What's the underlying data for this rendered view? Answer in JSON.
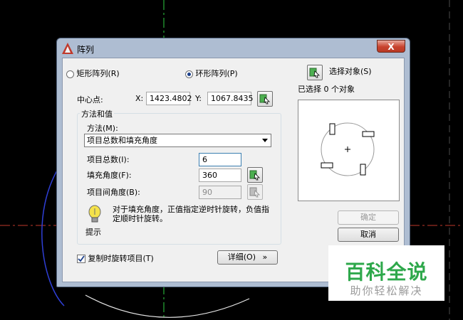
{
  "window": {
    "title": "阵列",
    "close_label": "X"
  },
  "array_type": {
    "rect_label": "矩形阵列",
    "rect_key": "(R)",
    "polar_label": "环形阵列",
    "polar_key": "(P)",
    "selected": "polar"
  },
  "select_objects": {
    "label": "选择对象",
    "key": "(S)",
    "status": "已选择 0 个对象"
  },
  "center_point": {
    "label": "中心点:",
    "x_label": "X:",
    "x_value": "1423.4802",
    "y_label": "Y:",
    "y_value": "1067.8435"
  },
  "method_group": {
    "title": "方法和值",
    "method_label": "方法(M):",
    "method_value": "项目总数和填充角度",
    "total_label": "项目总数(I):",
    "total_value": "6",
    "angle_label": "填充角度(F):",
    "angle_value": "360",
    "between_label": "项目间角度(B):",
    "between_value": "90"
  },
  "tip": {
    "label": "提示",
    "text": "对于填充角度，正值指定逆时针旋转，负值指定顺时针旋转。"
  },
  "options": {
    "rotate_label": "复制时旋转项目",
    "rotate_key": "(T)",
    "rotate_checked": true,
    "details_label": "详细",
    "details_key": "(O)",
    "details_chevron": "»"
  },
  "buttons": {
    "ok_label": "确定",
    "cancel_label": "取消"
  },
  "watermark": {
    "main": "百科全说",
    "sub": "助你轻松解决"
  }
}
